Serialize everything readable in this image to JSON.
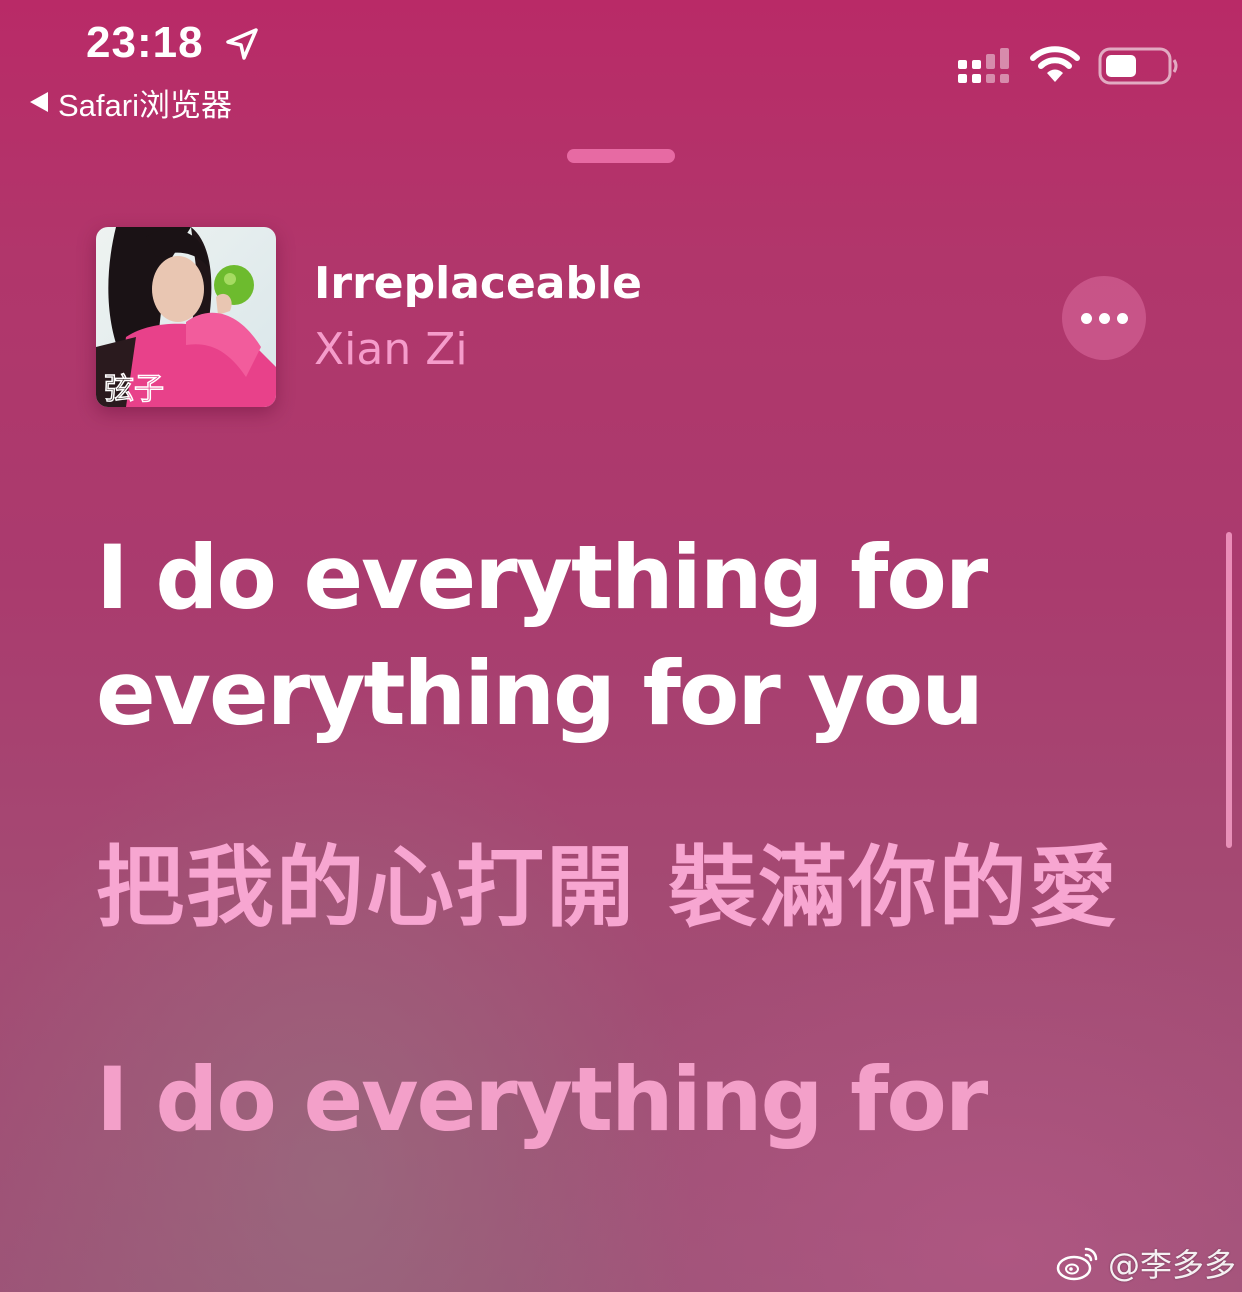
{
  "status_bar": {
    "time": "23:18",
    "back_label": "Safari浏览器",
    "icons": [
      "location-arrow-icon",
      "signal-icon",
      "wifi-icon",
      "battery-icon"
    ]
  },
  "now_playing": {
    "title": "Irreplaceable",
    "artist": "Xian Zi",
    "album_art_text": "弦子",
    "more_icon": "ellipsis-icon"
  },
  "lyrics": {
    "active_line": "I do everything for everything for you",
    "next_line": "把我的心打開 裝滿你的愛",
    "later_line": "I do everything for"
  },
  "watermark": {
    "text": "@李多多",
    "icon": "weibo-icon"
  },
  "colors": {
    "background_top": "#b92a67",
    "background_bottom": "#9d5377",
    "artist_pink": "#f59ccb",
    "upcoming_lyric_pink": "#f7a6d1",
    "grabber": "#e76aa3"
  }
}
